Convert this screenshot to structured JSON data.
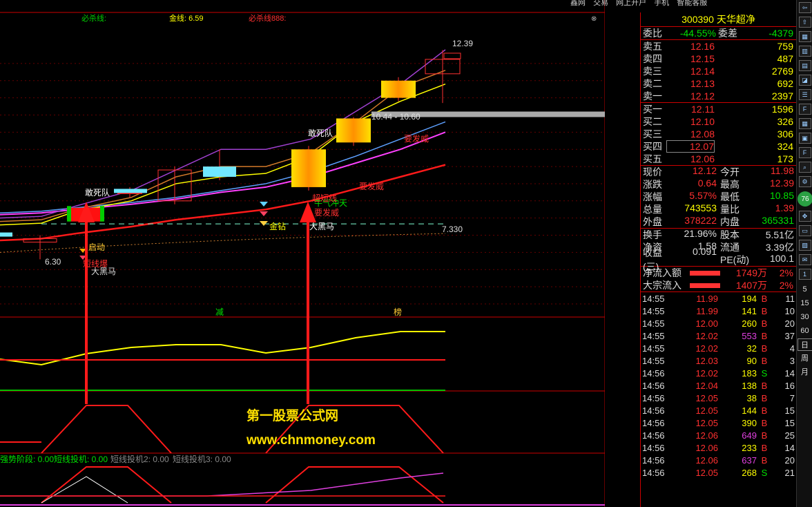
{
  "menu": [
    "鑫网",
    "交易",
    "网上开户",
    "手机",
    "智能客服"
  ],
  "main_labels": {
    "l1": "必杀线:",
    "l2": "金线: 6.59",
    "l3": "必杀线888:"
  },
  "panel3_labels": {
    "a": "强势阶段: 0.00",
    "b": "短线投机: 0.00",
    "c": "短线投机2: 0.00",
    "d": "短线投机3: 0.00"
  },
  "watermark": {
    "line1": "第一股票公式网",
    "line2": "www.chnmoney.com"
  },
  "chart_data": {
    "type": "candlestick",
    "price_axis": {
      "min": 5.0,
      "max": 12.4,
      "ticks": [
        "12.00",
        "11.50",
        "11.00",
        "10.50",
        "10.00",
        "9.50",
        "9.00",
        "8.50",
        "8.00",
        "7.50",
        "7.00",
        "6.50",
        "6.00",
        "5.50",
        "5.00"
      ]
    },
    "indicator1_ticks": [
      "300.0",
      "150.0"
    ],
    "indicator2_ticks": [
      "30.00",
      "15.00"
    ],
    "indicator3_ticks": [
      "40.00",
      "20.00"
    ],
    "candles": [
      {
        "o": 6.8,
        "c": 6.9,
        "h": 7.0,
        "l": 6.3,
        "hollow": true
      },
      {
        "o": 7.4,
        "c": 7.8,
        "h": 7.9,
        "l": 7.3,
        "hollow": false
      },
      {
        "o": 8.2,
        "c": 8.3,
        "h": 8.4,
        "l": 8.1,
        "hollow": false
      },
      {
        "o": 8.0,
        "c": 8.9,
        "h": 9.0,
        "l": 7.9,
        "hollow": true
      },
      {
        "o": 8.7,
        "c": 9.0,
        "h": 9.5,
        "l": 8.6,
        "hollow": false
      },
      {
        "o": 8.4,
        "c": 9.5,
        "h": 9.6,
        "l": 8.3,
        "hollow": false
      },
      {
        "o": 9.7,
        "c": 10.4,
        "h": 10.44,
        "l": 9.6,
        "hollow": false
      },
      {
        "o": 11.0,
        "c": 11.5,
        "h": 11.6,
        "l": 10.9,
        "hollow": false
      },
      {
        "o": 11.7,
        "c": 12.12,
        "h": 12.39,
        "l": 10.85,
        "hollow": true
      }
    ],
    "annotations": [
      "敢死队",
      "敢死队",
      "启动",
      "大黑马",
      "短线爆",
      "金钻",
      "大黑马",
      "牛气冲天",
      "超短线",
      "要发威",
      "要发威",
      "要发威",
      "12.39",
      "10.44 - 10.60",
      "7.330",
      "6.30",
      "减",
      "榜"
    ]
  },
  "quote": {
    "code": "300390",
    "name": "天华超净",
    "wb_label": "委比",
    "wb": "-44.55%",
    "wc_label": "委差",
    "wc": "-4379",
    "asks": [
      {
        "label": "卖五",
        "price": "12.16",
        "vol": "759"
      },
      {
        "label": "卖四",
        "price": "12.15",
        "vol": "487"
      },
      {
        "label": "卖三",
        "price": "12.14",
        "vol": "2769"
      },
      {
        "label": "卖二",
        "price": "12.13",
        "vol": "692"
      },
      {
        "label": "卖一",
        "price": "12.12",
        "vol": "2397"
      }
    ],
    "bids": [
      {
        "label": "买一",
        "price": "12.11",
        "vol": "1596"
      },
      {
        "label": "买二",
        "price": "12.10",
        "vol": "326"
      },
      {
        "label": "买三",
        "price": "12.08",
        "vol": "306"
      },
      {
        "label": "买四",
        "price": "12.07",
        "vol": "324"
      },
      {
        "label": "买五",
        "price": "12.06",
        "vol": "173"
      }
    ],
    "stats": [
      {
        "l1": "现价",
        "v1": "12.12",
        "c1": "red",
        "l2": "今开",
        "v2": "11.98",
        "c2": "red"
      },
      {
        "l1": "涨跌",
        "v1": "0.64",
        "c1": "red",
        "l2": "最高",
        "v2": "12.39",
        "c2": "red"
      },
      {
        "l1": "涨幅",
        "v1": "5.57%",
        "c1": "red",
        "l2": "最低",
        "v2": "10.85",
        "c2": "green"
      },
      {
        "l1": "总量",
        "v1": "743553",
        "c1": "yellow",
        "l2": "量比",
        "v2": "1.39",
        "c2": "red"
      },
      {
        "l1": "外盘",
        "v1": "378222",
        "c1": "red",
        "l2": "内盘",
        "v2": "365331",
        "c2": "green"
      }
    ],
    "stats2": [
      {
        "l1": "换手",
        "v1": "21.96%",
        "l2": "股本",
        "v2": "5.51亿"
      },
      {
        "l1": "净资",
        "v1": "1.58",
        "l2": "流通",
        "v2": "3.39亿"
      },
      {
        "l1": "收益(三)",
        "v1": "0.091",
        "l2": "PE(动)",
        "v2": "100.1"
      }
    ],
    "flows": [
      {
        "label": "净流入额",
        "amount": "1749万",
        "pct": "2%"
      },
      {
        "label": "大宗流入",
        "amount": "1407万",
        "pct": "2%"
      }
    ],
    "ticks": [
      {
        "t": "14:55",
        "p": "11.99",
        "v": "194",
        "vc": "yellow",
        "bs": "B",
        "n": "11"
      },
      {
        "t": "14:55",
        "p": "11.99",
        "v": "141",
        "vc": "yellow",
        "bs": "B",
        "n": "10"
      },
      {
        "t": "14:55",
        "p": "12.00",
        "v": "260",
        "vc": "yellow",
        "bs": "B",
        "n": "20"
      },
      {
        "t": "14:55",
        "p": "12.02",
        "v": "553",
        "vc": "purple",
        "bs": "B",
        "n": "37"
      },
      {
        "t": "14:55",
        "p": "12.02",
        "v": "32",
        "vc": "yellow",
        "bs": "B",
        "n": "4"
      },
      {
        "t": "14:55",
        "p": "12.03",
        "v": "90",
        "vc": "yellow",
        "bs": "B",
        "n": "3"
      },
      {
        "t": "14:56",
        "p": "12.02",
        "v": "183",
        "vc": "yellow",
        "bs": "S",
        "n": "14"
      },
      {
        "t": "14:56",
        "p": "12.04",
        "v": "138",
        "vc": "yellow",
        "bs": "B",
        "n": "16"
      },
      {
        "t": "14:56",
        "p": "12.05",
        "v": "38",
        "vc": "yellow",
        "bs": "B",
        "n": "7"
      },
      {
        "t": "14:56",
        "p": "12.05",
        "v": "144",
        "vc": "yellow",
        "bs": "B",
        "n": "15"
      },
      {
        "t": "14:56",
        "p": "12.05",
        "v": "390",
        "vc": "yellow",
        "bs": "B",
        "n": "15"
      },
      {
        "t": "14:56",
        "p": "12.06",
        "v": "649",
        "vc": "purple",
        "bs": "B",
        "n": "25"
      },
      {
        "t": "14:56",
        "p": "12.06",
        "v": "233",
        "vc": "yellow",
        "bs": "B",
        "n": "14"
      },
      {
        "t": "14:56",
        "p": "12.06",
        "v": "637",
        "vc": "purple",
        "bs": "B",
        "n": "20"
      },
      {
        "t": "14:56",
        "p": "12.05",
        "v": "268",
        "vc": "yellow",
        "bs": "S",
        "n": "21"
      }
    ]
  },
  "sidebar_text": [
    "5",
    "15",
    "30",
    "60",
    "日",
    "周",
    "月"
  ],
  "sidebar_badge": "76"
}
